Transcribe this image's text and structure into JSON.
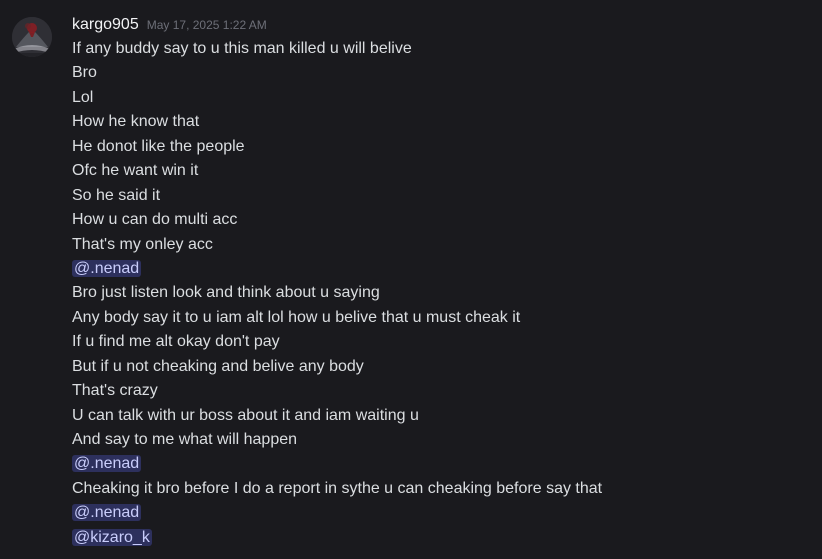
{
  "message": {
    "author": "kargo905",
    "timestamp": "May 17, 2025 1:22 AM",
    "lines": [
      {
        "text": "If any buddy say to u this man killed u will belive",
        "mention": false
      },
      {
        "text": "Bro",
        "mention": false
      },
      {
        "text": "Lol",
        "mention": false
      },
      {
        "text": "How he know that",
        "mention": false
      },
      {
        "text": "He donot like the people",
        "mention": false
      },
      {
        "text": "Ofc he want win it",
        "mention": false
      },
      {
        "text": "So he said it",
        "mention": false
      },
      {
        "text": "How u can do multi acc",
        "mention": false
      },
      {
        "text": "That's my onley acc",
        "mention": false
      },
      {
        "text": "@.nenad",
        "mention": true
      },
      {
        "text": "Bro just listen look and think about u saying",
        "mention": false
      },
      {
        "text": "Any body say it to u iam alt lol how u belive that u must cheak it",
        "mention": false
      },
      {
        "text": "If u find me alt okay don't pay",
        "mention": false
      },
      {
        "text": "But if u not cheaking and belive any body",
        "mention": false
      },
      {
        "text": "That's crazy",
        "mention": false
      },
      {
        "text": "U can talk with ur boss about it and iam waiting u",
        "mention": false
      },
      {
        "text": "And say to me what will happen",
        "mention": false
      },
      {
        "text": "@.nenad",
        "mention": true
      },
      {
        "text": "Cheaking it bro before I do a report in sythe u can cheaking before say that",
        "mention": false
      },
      {
        "text": "@.nenad",
        "mention": true
      },
      {
        "text": "@kizaro_k",
        "mention": true
      }
    ]
  },
  "colors": {
    "background": "#1a1a1e",
    "text": "#dbdee1",
    "username": "#f2f3f5",
    "timestamp": "#6d6f78",
    "mention_bg": "rgba(88,101,242,0.3)",
    "mention_text": "#c9cdfb"
  },
  "icons": {
    "avatar": "volcano-avatar-icon"
  }
}
